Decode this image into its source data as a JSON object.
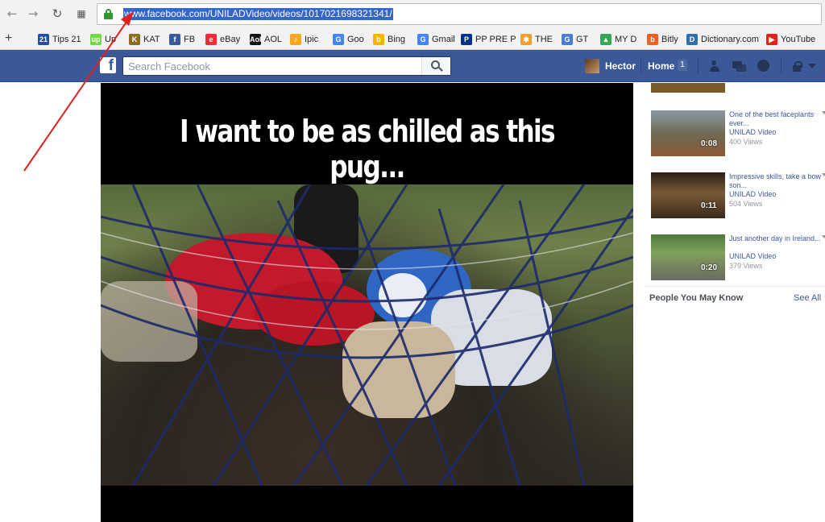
{
  "browser": {
    "url": "www.facebook.com/UNILADVideo/videos/1017021698321341/",
    "bookmarks": [
      {
        "label": "Tips 21",
        "icon": "tips21-icon",
        "color": "#1e4fa3",
        "glyph": "21"
      },
      {
        "label": "Up",
        "icon": "upwork-icon",
        "color": "#6fda44",
        "glyph": "up"
      },
      {
        "label": "KAT",
        "icon": "kat-icon",
        "color": "#8a6d1f",
        "glyph": "K"
      },
      {
        "label": "FB",
        "icon": "facebook-icon",
        "color": "#3b5998",
        "glyph": "f"
      },
      {
        "label": "eBay",
        "icon": "ebay-icon",
        "color": "#e53238",
        "glyph": "e"
      },
      {
        "label": "AOL",
        "icon": "aol-icon",
        "color": "#111111",
        "glyph": "Aol"
      },
      {
        "label": "Ipic",
        "icon": "ipic-icon",
        "color": "#f5a623",
        "glyph": "♪"
      },
      {
        "label": "Goo",
        "icon": "google-icon",
        "color": "#4285f4",
        "glyph": "G"
      },
      {
        "label": "Bing",
        "icon": "bing-icon",
        "color": "#f4b400",
        "glyph": "b"
      },
      {
        "label": "Gmail",
        "icon": "gmail-icon",
        "color": "#4285f4",
        "glyph": "G"
      },
      {
        "label": "PP PRE P",
        "icon": "paypal-icon",
        "color": "#003087",
        "glyph": "P"
      },
      {
        "label": "THE",
        "icon": "the-icon",
        "color": "#f0a030",
        "glyph": "✱"
      },
      {
        "label": "GT",
        "icon": "translate-icon",
        "color": "#4a7bd8",
        "glyph": "G"
      },
      {
        "label": "MY D",
        "icon": "drive-icon",
        "color": "#34a853",
        "glyph": "▲"
      },
      {
        "label": "Bitly",
        "icon": "bitly-icon",
        "color": "#ee6123",
        "glyph": "b"
      },
      {
        "label": "Dictionary.com",
        "icon": "dictionary-icon",
        "color": "#2f6fb0",
        "glyph": "D"
      },
      {
        "label": "YouTube",
        "icon": "youtube-icon",
        "color": "#e62117",
        "glyph": "▶"
      }
    ]
  },
  "facebook": {
    "search_placeholder": "Search Facebook",
    "username": "Hector",
    "home_label": "Home",
    "home_count": "1"
  },
  "video": {
    "caption": "I want to be as chilled as this pug..."
  },
  "related": [
    {
      "title": "One of the best faceplants ever...",
      "channel": "UNILAD Video",
      "views": "400 Views",
      "duration": "0:08"
    },
    {
      "title": "Impressive skills, take a bow son...",
      "channel": "UNILAD Video",
      "views": "504 Views",
      "duration": "0:11"
    },
    {
      "title": "Just another day in Ireland...",
      "channel": "UNILAD Video",
      "views": "379 Views",
      "duration": "0:20"
    }
  ],
  "sidebar": {
    "people_title": "People You May Know",
    "see_all": "See All"
  },
  "colors": {
    "fb_blue": "#3b5998",
    "url_highlight": "#3366cc",
    "arrow": "#e02020"
  }
}
